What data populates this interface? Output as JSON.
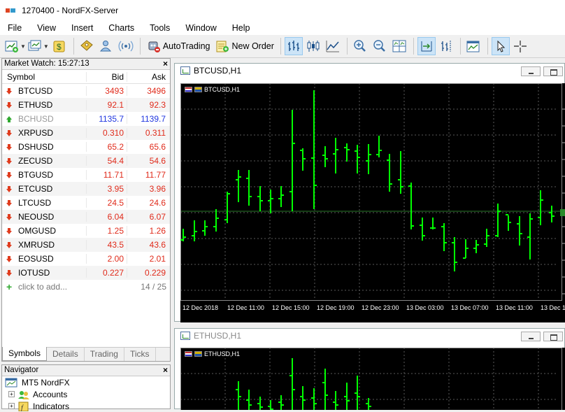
{
  "titlebar": {
    "title": "1270400 - NordFX-Server"
  },
  "menu": [
    "File",
    "View",
    "Insert",
    "Charts",
    "Tools",
    "Window",
    "Help"
  ],
  "toolbar": {
    "autotrading_label": "AutoTrading",
    "new_order_label": "New Order"
  },
  "market_watch": {
    "title": "Market Watch: 15:27:13",
    "columns": {
      "symbol": "Symbol",
      "bid": "Bid",
      "ask": "Ask"
    },
    "rows": [
      {
        "symbol": "BTCUSD",
        "bid": "3493",
        "ask": "3496",
        "dir": "down",
        "color": "red"
      },
      {
        "symbol": "ETHUSD",
        "bid": "92.1",
        "ask": "92.3",
        "dir": "down",
        "color": "red"
      },
      {
        "symbol": "BCHUSD",
        "bid": "1135.7",
        "ask": "1139.7",
        "dir": "up",
        "color": "blue",
        "muted": true
      },
      {
        "symbol": "XRPUSD",
        "bid": "0.310",
        "ask": "0.311",
        "dir": "down",
        "color": "red"
      },
      {
        "symbol": "DSHUSD",
        "bid": "65.2",
        "ask": "65.6",
        "dir": "down",
        "color": "red"
      },
      {
        "symbol": "ZECUSD",
        "bid": "54.4",
        "ask": "54.6",
        "dir": "down",
        "color": "red"
      },
      {
        "symbol": "BTGUSD",
        "bid": "11.71",
        "ask": "11.77",
        "dir": "down",
        "color": "red"
      },
      {
        "symbol": "ETCUSD",
        "bid": "3.95",
        "ask": "3.96",
        "dir": "down",
        "color": "red"
      },
      {
        "symbol": "LTCUSD",
        "bid": "24.5",
        "ask": "24.6",
        "dir": "down",
        "color": "red"
      },
      {
        "symbol": "NEOUSD",
        "bid": "6.04",
        "ask": "6.07",
        "dir": "down",
        "color": "red"
      },
      {
        "symbol": "OMGUSD",
        "bid": "1.25",
        "ask": "1.26",
        "dir": "down",
        "color": "red"
      },
      {
        "symbol": "XMRUSD",
        "bid": "43.5",
        "ask": "43.6",
        "dir": "down",
        "color": "red"
      },
      {
        "symbol": "EOSUSD",
        "bid": "2.00",
        "ask": "2.01",
        "dir": "down",
        "color": "red"
      },
      {
        "symbol": "IOTUSD",
        "bid": "0.227",
        "ask": "0.229",
        "dir": "down",
        "color": "red"
      }
    ],
    "add_label": "click to add...",
    "count": "14 / 25",
    "tabs": [
      "Symbols",
      "Details",
      "Trading",
      "Ticks"
    ]
  },
  "navigator": {
    "title": "Navigator",
    "items": [
      "MT5 NordFX",
      "Accounts",
      "Indicators"
    ]
  },
  "charts": {
    "btc": {
      "window_title": "BTCUSD,H1",
      "label": "BTCUSD,H1",
      "time_labels": [
        "12 Dec 2018",
        "12 Dec 11:00",
        "12 Dec 15:00",
        "12 Dec 19:00",
        "12 Dec 23:00",
        "13 Dec 03:00",
        "13 Dec 07:00",
        "13 Dec 11:00",
        "13 Dec 1"
      ]
    },
    "eth": {
      "window_title": "ETHUSD,H1",
      "label": "ETHUSD,H1"
    }
  },
  "colors": {
    "bar": "#00ff00",
    "grid": "#5a5a5a",
    "chart_bg": "#000000",
    "bid_red": "#e02a1a",
    "bid_blue": "#1f36e0"
  }
}
